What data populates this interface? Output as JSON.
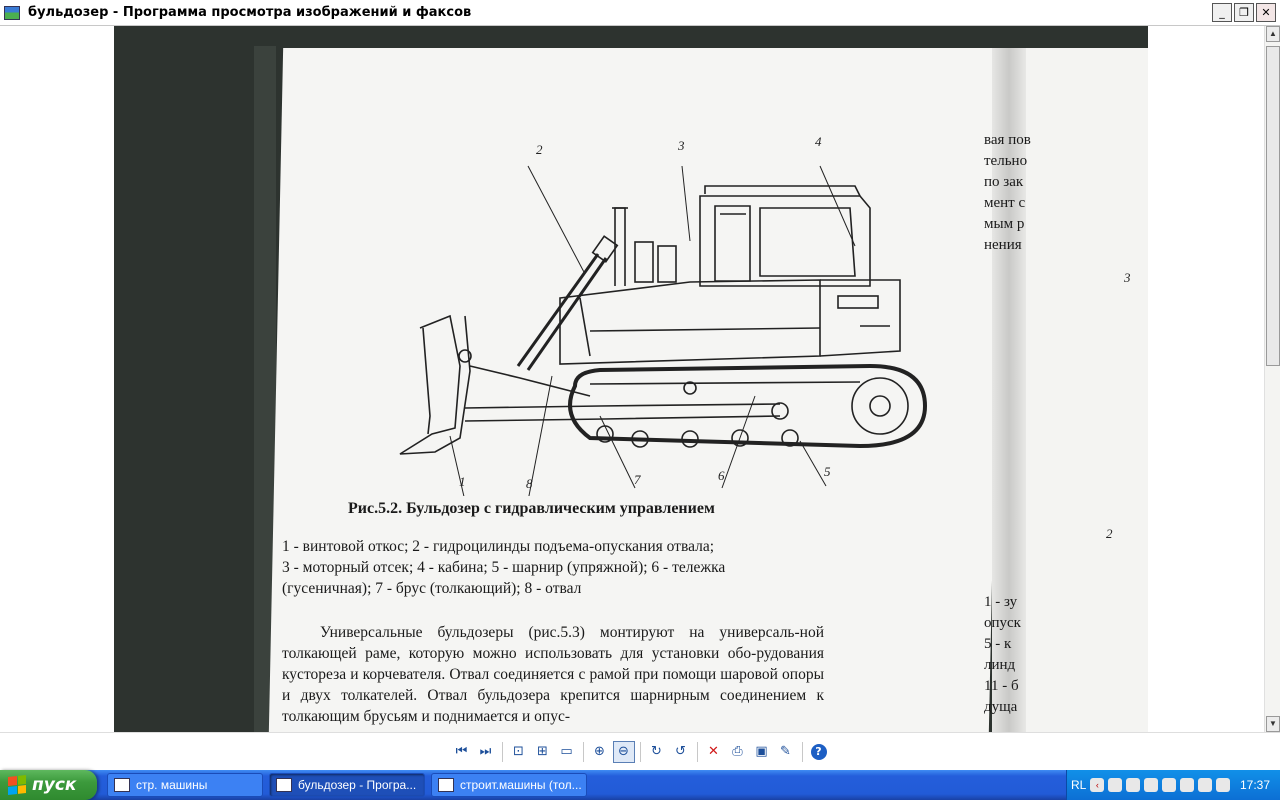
{
  "window": {
    "title": "бульдозер - Программа просмотра изображений и факсов",
    "min_glyph": "_",
    "max_glyph": "❐",
    "close_glyph": "✕"
  },
  "document": {
    "fig_numbers": [
      "1",
      "2",
      "3",
      "4",
      "5",
      "6",
      "7",
      "8"
    ],
    "caption": "Рис.5.2. Бульдозер с гидравлическим управлением",
    "legend_lines": [
      "1 - винтовой откос; 2 - гидроцилинды подъема-опускания отвала;",
      "3 - моторный отсек; 4 - кабина; 5 - шарнир (упряжной); 6 - тележка",
      "(гусеничная); 7 - брус (толкающий); 8 - отвал"
    ],
    "paragraph": "Универсальные бульдозеры (рис.5.3) монтируют на универсаль-ной толкающей раме, которую можно использовать для установки обо-рудования кустореза и корчевателя. Отвал соединяется с рамой при помощи шаровой опоры и двух толкателей. Отвал бульдозера крепится шарнирным соединением к толкающим брусьям и поднимается и опус-",
    "right_page_top": [
      "вая пов",
      "тельно",
      "по зак",
      "мент с",
      "мым р",
      "нения"
    ],
    "right_page_bottom": [
      "1 - зу",
      "опуск",
      "5 - к",
      "линд",
      "11 - б",
      "дуща"
    ],
    "right_page_numbers": [
      "3",
      "2"
    ]
  },
  "toolbar": {
    "buttons": [
      {
        "name": "prev-image-button",
        "icon": "prev-icon",
        "glyph": "⏮"
      },
      {
        "name": "next-image-button",
        "icon": "next-icon",
        "glyph": "⏭"
      },
      {
        "name": "best-fit-button",
        "icon": "best-fit-icon",
        "glyph": "⊡"
      },
      {
        "name": "actual-size-button",
        "icon": "actual-size-icon",
        "glyph": "⊞"
      },
      {
        "name": "slideshow-button",
        "icon": "slideshow-icon",
        "glyph": "▭"
      },
      {
        "name": "zoom-in-button",
        "icon": "zoom-in-icon",
        "glyph": "⊕"
      },
      {
        "name": "zoom-out-button",
        "icon": "zoom-out-icon",
        "glyph": "⊖"
      },
      {
        "name": "rotate-cw-button",
        "icon": "rotate-cw-icon",
        "glyph": "↻"
      },
      {
        "name": "rotate-ccw-button",
        "icon": "rotate-ccw-icon",
        "glyph": "↺"
      },
      {
        "name": "delete-button",
        "icon": "delete-icon",
        "glyph": "✕"
      },
      {
        "name": "print-button",
        "icon": "print-icon",
        "glyph": "⎙"
      },
      {
        "name": "save-button",
        "icon": "save-icon",
        "glyph": "▣"
      },
      {
        "name": "edit-button",
        "icon": "edit-icon",
        "glyph": "✎"
      },
      {
        "name": "help-button",
        "icon": "help-icon",
        "glyph": "?"
      }
    ]
  },
  "taskbar": {
    "start_label": "пуск",
    "tasks": [
      {
        "label": "стр. машины",
        "active": false
      },
      {
        "label": "бульдозер - Програ...",
        "active": true
      },
      {
        "label": "строит.машины (тол...",
        "active": false
      }
    ],
    "lang": "RL",
    "clock": "17:37"
  },
  "colors": {
    "taskbar": "#245edb",
    "start": "#3c9a3c",
    "tray": "#0c6fd4",
    "page": "#f5f5f3",
    "scan_bg": "#2d332f"
  }
}
